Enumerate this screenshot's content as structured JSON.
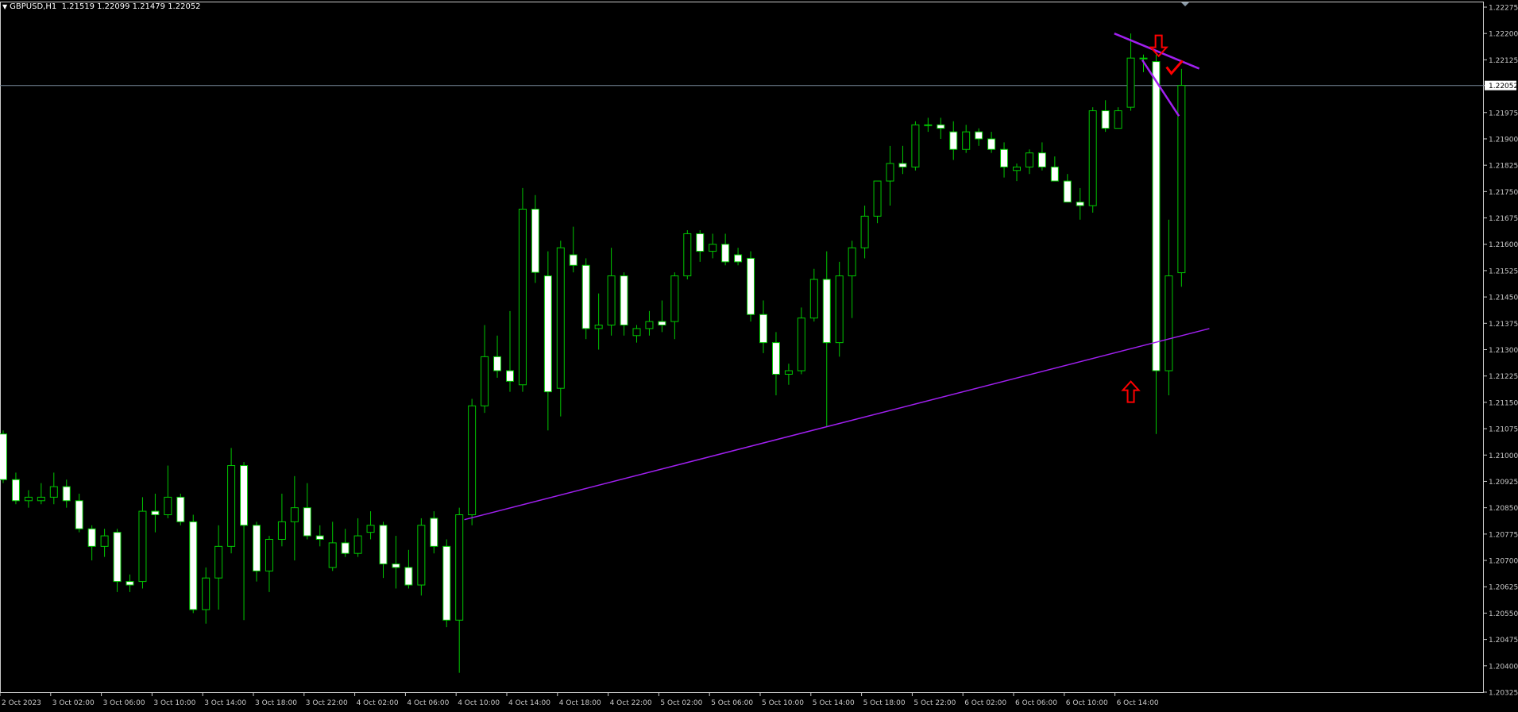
{
  "window": {
    "symbol_label": "GBPUSD,H1",
    "ohlc": "1.21519 1.22099 1.21479 1.22052"
  },
  "colors": {
    "background": "#000000",
    "axis": "#c8c8c8",
    "bull_candle": "#000000",
    "bear_candle": "#ffffff",
    "wick": "#00c800",
    "trendline": "#a020f0",
    "arrow": "#ff0000",
    "price_line": "#778899"
  },
  "chart_data": {
    "type": "candlestick",
    "symbol": "GBPUSD",
    "timeframe": "H1",
    "current_price": "1.22052",
    "ylim": [
      1.20325,
      1.22275
    ],
    "y_ticks": [
      "1.22275",
      "1.22200",
      "1.22125",
      "1.22052",
      "1.21975",
      "1.21900",
      "1.21825",
      "1.21750",
      "1.21675",
      "1.21600",
      "1.21525",
      "1.21450",
      "1.21375",
      "1.21300",
      "1.21225",
      "1.21150",
      "1.21075",
      "1.21000",
      "1.20925",
      "1.20850",
      "1.20775",
      "1.20700",
      "1.20625",
      "1.20550",
      "1.20475",
      "1.20400",
      "1.20325"
    ],
    "x_ticks": [
      {
        "label": "2 Oct 2023",
        "index": 0
      },
      {
        "label": "3 Oct 02:00",
        "index": 4
      },
      {
        "label": "3 Oct 06:00",
        "index": 8
      },
      {
        "label": "3 Oct 10:00",
        "index": 12
      },
      {
        "label": "3 Oct 14:00",
        "index": 16
      },
      {
        "label": "3 Oct 18:00",
        "index": 20
      },
      {
        "label": "3 Oct 22:00",
        "index": 24
      },
      {
        "label": "4 Oct 02:00",
        "index": 28
      },
      {
        "label": "4 Oct 06:00",
        "index": 32
      },
      {
        "label": "4 Oct 10:00",
        "index": 36
      },
      {
        "label": "4 Oct 14:00",
        "index": 40
      },
      {
        "label": "4 Oct 18:00",
        "index": 44
      },
      {
        "label": "4 Oct 22:00",
        "index": 48
      },
      {
        "label": "5 Oct 02:00",
        "index": 52
      },
      {
        "label": "5 Oct 06:00",
        "index": 56
      },
      {
        "label": "5 Oct 10:00",
        "index": 60
      },
      {
        "label": "5 Oct 14:00",
        "index": 64
      },
      {
        "label": "5 Oct 18:00",
        "index": 68
      },
      {
        "label": "5 Oct 22:00",
        "index": 72
      },
      {
        "label": "6 Oct 02:00",
        "index": 76
      },
      {
        "label": "6 Oct 06:00",
        "index": 80
      },
      {
        "label": "6 Oct 10:00",
        "index": 84
      },
      {
        "label": "6 Oct 14:00",
        "index": 88
      }
    ],
    "candles": [
      {
        "o": 1.2106,
        "h": 1.2107,
        "l": 1.2092,
        "c": 1.2093
      },
      {
        "o": 1.2093,
        "h": 1.2095,
        "l": 1.2086,
        "c": 1.2087
      },
      {
        "o": 1.2087,
        "h": 1.209,
        "l": 1.2085,
        "c": 1.2088
      },
      {
        "o": 1.2087,
        "h": 1.2092,
        "l": 1.2086,
        "c": 1.2088
      },
      {
        "o": 1.2088,
        "h": 1.2095,
        "l": 1.2086,
        "c": 1.2091
      },
      {
        "o": 1.2091,
        "h": 1.2093,
        "l": 1.2085,
        "c": 1.2087
      },
      {
        "o": 1.2087,
        "h": 1.2089,
        "l": 1.2078,
        "c": 1.2079
      },
      {
        "o": 1.2079,
        "h": 1.208,
        "l": 1.207,
        "c": 1.2074
      },
      {
        "o": 1.2074,
        "h": 1.2079,
        "l": 1.2071,
        "c": 1.2077
      },
      {
        "o": 1.2078,
        "h": 1.2079,
        "l": 1.2061,
        "c": 1.2064
      },
      {
        "o": 1.2064,
        "h": 1.2066,
        "l": 1.2061,
        "c": 1.2063
      },
      {
        "o": 1.2064,
        "h": 1.2088,
        "l": 1.2062,
        "c": 1.2084
      },
      {
        "o": 1.2084,
        "h": 1.2089,
        "l": 1.2078,
        "c": 1.2083
      },
      {
        "o": 1.2083,
        "h": 1.2097,
        "l": 1.2082,
        "c": 1.2088
      },
      {
        "o": 1.2088,
        "h": 1.2089,
        "l": 1.208,
        "c": 1.2081
      },
      {
        "o": 1.2081,
        "h": 1.2083,
        "l": 1.2055,
        "c": 1.2056
      },
      {
        "o": 1.2056,
        "h": 1.2068,
        "l": 1.2052,
        "c": 1.2065
      },
      {
        "o": 1.2065,
        "h": 1.208,
        "l": 1.2056,
        "c": 1.2074
      },
      {
        "o": 1.2074,
        "h": 1.2102,
        "l": 1.2072,
        "c": 1.2097
      },
      {
        "o": 1.2097,
        "h": 1.2098,
        "l": 1.2053,
        "c": 1.208
      },
      {
        "o": 1.208,
        "h": 1.2081,
        "l": 1.2064,
        "c": 1.2067
      },
      {
        "o": 1.2067,
        "h": 1.2077,
        "l": 1.2061,
        "c": 1.2076
      },
      {
        "o": 1.2076,
        "h": 1.2089,
        "l": 1.2074,
        "c": 1.2081
      },
      {
        "o": 1.2081,
        "h": 1.2094,
        "l": 1.207,
        "c": 1.2085
      },
      {
        "o": 1.2085,
        "h": 1.2092,
        "l": 1.2076,
        "c": 1.2077
      },
      {
        "o": 1.2077,
        "h": 1.208,
        "l": 1.2074,
        "c": 1.2076
      },
      {
        "o": 1.2068,
        "h": 1.2081,
        "l": 1.2067,
        "c": 1.2075
      },
      {
        "o": 1.2075,
        "h": 1.2079,
        "l": 1.2071,
        "c": 1.2072
      },
      {
        "o": 1.2072,
        "h": 1.2082,
        "l": 1.2071,
        "c": 1.2077
      },
      {
        "o": 1.2078,
        "h": 1.2084,
        "l": 1.2076,
        "c": 1.208
      },
      {
        "o": 1.208,
        "h": 1.2081,
        "l": 1.2065,
        "c": 1.2069
      },
      {
        "o": 1.2069,
        "h": 1.2077,
        "l": 1.2062,
        "c": 1.2068
      },
      {
        "o": 1.2068,
        "h": 1.2073,
        "l": 1.2062,
        "c": 1.2063
      },
      {
        "o": 1.2063,
        "h": 1.2082,
        "l": 1.206,
        "c": 1.208
      },
      {
        "o": 1.2082,
        "h": 1.2084,
        "l": 1.2072,
        "c": 1.2074
      },
      {
        "o": 1.2074,
        "h": 1.2076,
        "l": 1.2051,
        "c": 1.2053
      },
      {
        "o": 1.2053,
        "h": 1.2085,
        "l": 1.2038,
        "c": 1.2083
      },
      {
        "o": 1.2083,
        "h": 1.2116,
        "l": 1.208,
        "c": 1.2114
      },
      {
        "o": 1.2114,
        "h": 1.2137,
        "l": 1.2112,
        "c": 1.2128
      },
      {
        "o": 1.2128,
        "h": 1.2134,
        "l": 1.2122,
        "c": 1.2124
      },
      {
        "o": 1.2124,
        "h": 1.2141,
        "l": 1.2118,
        "c": 1.2121
      },
      {
        "o": 1.212,
        "h": 1.2176,
        "l": 1.2118,
        "c": 1.217
      },
      {
        "o": 1.217,
        "h": 1.2174,
        "l": 1.2149,
        "c": 1.2152
      },
      {
        "o": 1.2151,
        "h": 1.2158,
        "l": 1.2107,
        "c": 1.2118
      },
      {
        "o": 1.2119,
        "h": 1.2161,
        "l": 1.2111,
        "c": 1.2159
      },
      {
        "o": 1.2157,
        "h": 1.2165,
        "l": 1.2152,
        "c": 1.2154
      },
      {
        "o": 1.2154,
        "h": 1.2156,
        "l": 1.2133,
        "c": 1.2136
      },
      {
        "o": 1.2136,
        "h": 1.2146,
        "l": 1.213,
        "c": 1.2137
      },
      {
        "o": 1.2137,
        "h": 1.2159,
        "l": 1.2134,
        "c": 1.2151
      },
      {
        "o": 1.2151,
        "h": 1.2152,
        "l": 1.2134,
        "c": 1.2137
      },
      {
        "o": 1.2134,
        "h": 1.2137,
        "l": 1.2132,
        "c": 1.2136
      },
      {
        "o": 1.2136,
        "h": 1.2141,
        "l": 1.2134,
        "c": 1.2138
      },
      {
        "o": 1.2138,
        "h": 1.2144,
        "l": 1.2135,
        "c": 1.2137
      },
      {
        "o": 1.2138,
        "h": 1.2152,
        "l": 1.2133,
        "c": 1.2151
      },
      {
        "o": 1.2151,
        "h": 1.2164,
        "l": 1.215,
        "c": 1.2163
      },
      {
        "o": 1.2163,
        "h": 1.2164,
        "l": 1.2155,
        "c": 1.2158
      },
      {
        "o": 1.2158,
        "h": 1.2163,
        "l": 1.2156,
        "c": 1.216
      },
      {
        "o": 1.216,
        "h": 1.2163,
        "l": 1.2154,
        "c": 1.2155
      },
      {
        "o": 1.2157,
        "h": 1.2159,
        "l": 1.2154,
        "c": 1.2155
      },
      {
        "o": 1.2156,
        "h": 1.2158,
        "l": 1.2138,
        "c": 1.214
      },
      {
        "o": 1.214,
        "h": 1.2144,
        "l": 1.2129,
        "c": 1.2132
      },
      {
        "o": 1.2132,
        "h": 1.2135,
        "l": 1.2117,
        "c": 1.2123
      },
      {
        "o": 1.2123,
        "h": 1.2126,
        "l": 1.212,
        "c": 1.2124
      },
      {
        "o": 1.2124,
        "h": 1.2142,
        "l": 1.2123,
        "c": 1.2139
      },
      {
        "o": 1.2139,
        "h": 1.2153,
        "l": 1.2138,
        "c": 1.215
      },
      {
        "o": 1.215,
        "h": 1.2158,
        "l": 1.2108,
        "c": 1.2132
      },
      {
        "o": 1.2132,
        "h": 1.2155,
        "l": 1.2128,
        "c": 1.2151
      },
      {
        "o": 1.2151,
        "h": 1.2161,
        "l": 1.2139,
        "c": 1.2159
      },
      {
        "o": 1.2159,
        "h": 1.2171,
        "l": 1.2156,
        "c": 1.2168
      },
      {
        "o": 1.2168,
        "h": 1.2178,
        "l": 1.2166,
        "c": 1.2178
      },
      {
        "o": 1.2178,
        "h": 1.2188,
        "l": 1.2171,
        "c": 1.2183
      },
      {
        "o": 1.2183,
        "h": 1.2188,
        "l": 1.218,
        "c": 1.2182
      },
      {
        "o": 1.2182,
        "h": 1.2195,
        "l": 1.2181,
        "c": 1.2194
      },
      {
        "o": 1.2194,
        "h": 1.2196,
        "l": 1.2192,
        "c": 1.2194
      },
      {
        "o": 1.2194,
        "h": 1.2196,
        "l": 1.219,
        "c": 1.2193
      },
      {
        "o": 1.2192,
        "h": 1.2195,
        "l": 1.2184,
        "c": 1.2187
      },
      {
        "o": 1.2187,
        "h": 1.2194,
        "l": 1.2186,
        "c": 1.2192
      },
      {
        "o": 1.2192,
        "h": 1.2193,
        "l": 1.2188,
        "c": 1.219
      },
      {
        "o": 1.219,
        "h": 1.2192,
        "l": 1.2186,
        "c": 1.2187
      },
      {
        "o": 1.2187,
        "h": 1.2189,
        "l": 1.2179,
        "c": 1.2182
      },
      {
        "o": 1.2181,
        "h": 1.2183,
        "l": 1.2178,
        "c": 1.2182
      },
      {
        "o": 1.2182,
        "h": 1.2187,
        "l": 1.218,
        "c": 1.2186
      },
      {
        "o": 1.2186,
        "h": 1.2189,
        "l": 1.2181,
        "c": 1.2182
      },
      {
        "o": 1.2182,
        "h": 1.2185,
        "l": 1.2178,
        "c": 1.2178
      },
      {
        "o": 1.2178,
        "h": 1.218,
        "l": 1.2172,
        "c": 1.2172
      },
      {
        "o": 1.2172,
        "h": 1.2176,
        "l": 1.2167,
        "c": 1.2171
      },
      {
        "o": 1.2171,
        "h": 1.2199,
        "l": 1.2169,
        "c": 1.2198
      },
      {
        "o": 1.2198,
        "h": 1.2201,
        "l": 1.2192,
        "c": 1.2193
      },
      {
        "o": 1.2193,
        "h": 1.2199,
        "l": 1.2193,
        "c": 1.2198
      },
      {
        "o": 1.2199,
        "h": 1.222,
        "l": 1.2198,
        "c": 1.2213
      },
      {
        "o": 1.2213,
        "h": 1.2214,
        "l": 1.2209,
        "c": 1.2213
      },
      {
        "o": 1.2212,
        "h": 1.2214,
        "l": 1.2106,
        "c": 1.2124
      },
      {
        "o": 1.2124,
        "h": 1.2167,
        "l": 1.2117,
        "c": 1.2151
      },
      {
        "o": 1.21519,
        "h": 1.22099,
        "l": 1.21479,
        "c": 1.22052
      }
    ],
    "trendlines": [
      {
        "from": {
          "index": 36.4,
          "price": 1.20816
        },
        "to": {
          "index": 95.2,
          "price": 1.2136
        }
      },
      {
        "from": {
          "index": 87.7,
          "price": 1.222
        },
        "to": {
          "index": 94.4,
          "price": 1.221
        }
      },
      {
        "from": {
          "index": 89.9,
          "price": 1.22125
        },
        "to": {
          "index": 92.8,
          "price": 1.21965
        }
      }
    ],
    "annotations": [
      {
        "type": "arrow-up",
        "index": 89,
        "price": 1.2118
      },
      {
        "type": "arrow-down",
        "index": 91.2,
        "price": 1.22165
      },
      {
        "type": "check",
        "index": 92.2,
        "price": 1.221
      }
    ],
    "grid": false,
    "legend": "none"
  }
}
